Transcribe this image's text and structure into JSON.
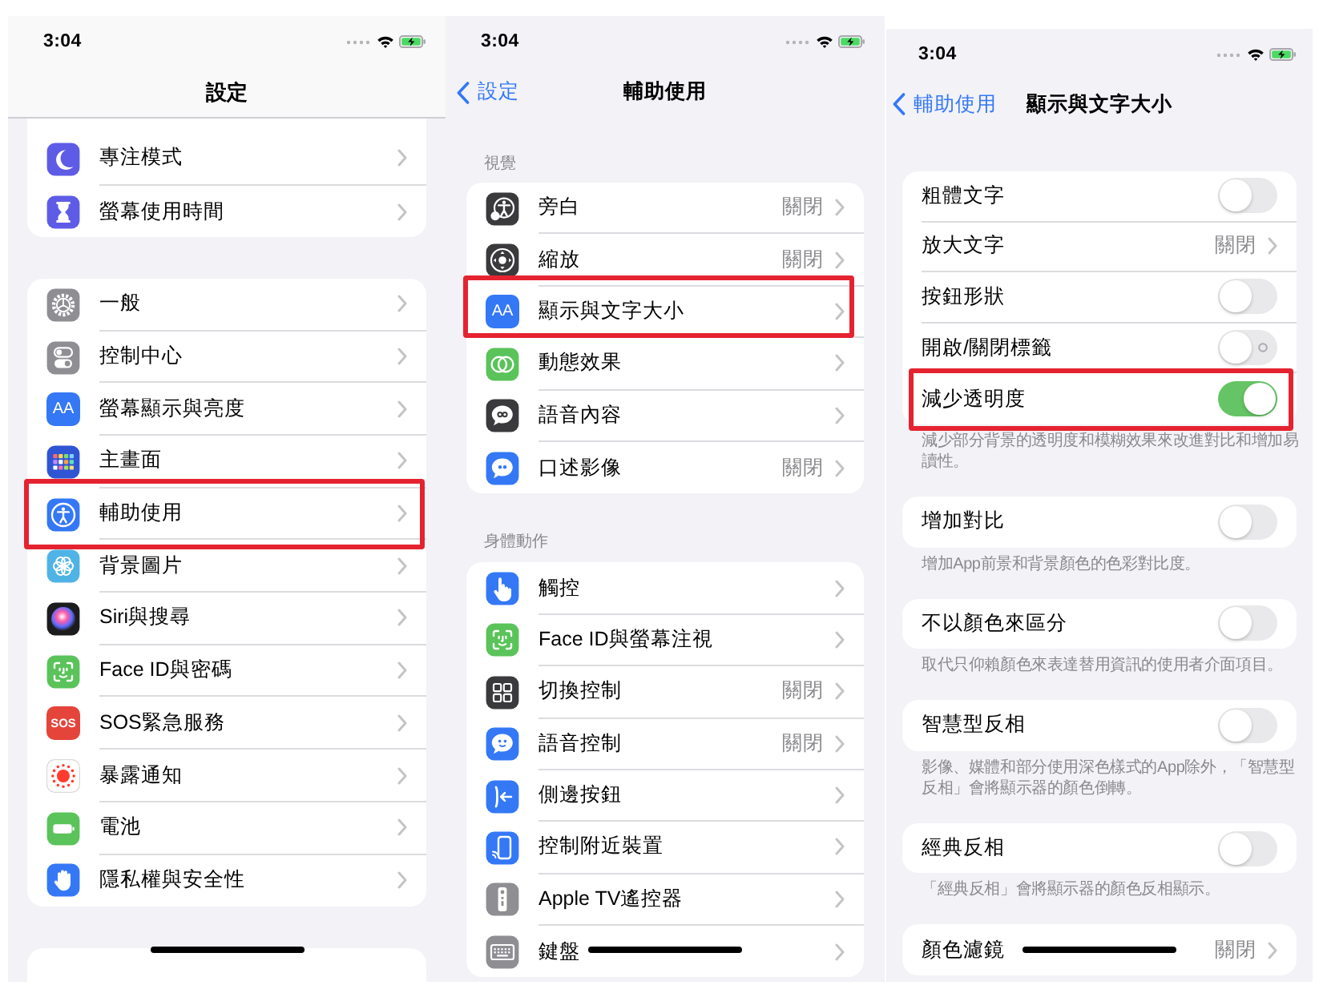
{
  "screens": [
    {
      "status_time": "3:04",
      "title": "設定",
      "groups": [
        {
          "items": [
            {
              "label": "專注模式",
              "highlighted": false
            },
            {
              "label": "螢幕使用時間",
              "highlighted": false
            }
          ]
        },
        {
          "items": [
            {
              "label": "一般",
              "highlighted": false
            },
            {
              "label": "控制中心",
              "highlighted": false
            },
            {
              "label": "螢幕顯示與亮度",
              "icon_text": "AA",
              "highlighted": false
            },
            {
              "label": "主畫面",
              "highlighted": false
            },
            {
              "label": "輔助使用",
              "highlighted": true
            },
            {
              "label": "背景圖片",
              "highlighted": false
            },
            {
              "label": "Siri與搜尋",
              "highlighted": false
            },
            {
              "label": "Face ID與密碼",
              "highlighted": false
            },
            {
              "label": "SOS緊急服務",
              "icon_text": "SOS",
              "highlighted": false
            },
            {
              "label": "暴露通知",
              "highlighted": false
            },
            {
              "label": "電池",
              "highlighted": false
            },
            {
              "label": "隱私權與安全性",
              "highlighted": false
            }
          ]
        }
      ]
    },
    {
      "status_time": "3:04",
      "back": "設定",
      "title": "輔助使用",
      "groups": [
        {
          "header": "視覺",
          "items": [
            {
              "label": "旁白",
              "value": "關閉",
              "highlighted": false
            },
            {
              "label": "縮放",
              "value": "關閉",
              "highlighted": false
            },
            {
              "label": "顯示與文字大小",
              "icon_text": "AA",
              "highlighted": true
            },
            {
              "label": "動態效果",
              "highlighted": false
            },
            {
              "label": "語音內容",
              "highlighted": false
            },
            {
              "label": "口述影像",
              "value": "關閉",
              "highlighted": false
            }
          ]
        },
        {
          "header": "身體動作",
          "items": [
            {
              "label": "觸控",
              "highlighted": false
            },
            {
              "label": "Face ID與螢幕注視",
              "highlighted": false
            },
            {
              "label": "切換控制",
              "value": "關閉",
              "highlighted": false
            },
            {
              "label": "語音控制",
              "value": "關閉",
              "highlighted": false
            },
            {
              "label": "側邊按鈕",
              "highlighted": false
            },
            {
              "label": "控制附近裝置",
              "highlighted": false
            },
            {
              "label": "Apple TV遙控器",
              "highlighted": false
            },
            {
              "label": "鍵盤",
              "highlighted": false
            }
          ]
        }
      ]
    },
    {
      "status_time": "3:04",
      "back": "輔助使用",
      "title": "顯示與文字大小",
      "groups": [
        {
          "items": [
            {
              "kind": "toggle",
              "label": "粗體文字",
              "on": false,
              "off_label": false,
              "highlighted": false
            },
            {
              "kind": "link",
              "label": "放大文字",
              "value": "關閉",
              "highlighted": false
            },
            {
              "kind": "toggle",
              "label": "按鈕形狀",
              "on": false,
              "off_label": false,
              "highlighted": false
            },
            {
              "kind": "toggle",
              "label": "開啟/關閉標籤",
              "on": false,
              "off_label": true,
              "highlighted": false
            },
            {
              "kind": "toggle",
              "label": "減少透明度",
              "on": true,
              "off_label": false,
              "highlighted": true
            }
          ],
          "footer": "減少部分背景的透明度和模糊效果來改進對比和增加易讀性。"
        },
        {
          "items": [
            {
              "kind": "toggle",
              "label": "增加對比",
              "on": false,
              "off_label": false,
              "highlighted": false
            }
          ],
          "footer": "增加App前景和背景顏色的色彩對比度。"
        },
        {
          "items": [
            {
              "kind": "toggle",
              "label": "不以顏色來區分",
              "on": false,
              "off_label": false,
              "highlighted": false
            }
          ],
          "footer": "取代只仰賴顏色來表達替用資訊的使用者介面項目。"
        },
        {
          "items": [
            {
              "kind": "toggle",
              "label": "智慧型反相",
              "on": false,
              "off_label": false,
              "highlighted": false
            }
          ],
          "footer": "影像、媒體和部分使用深色樣式的App除外，「智慧型反相」會將顯示器的顏色倒轉。"
        },
        {
          "items": [
            {
              "kind": "toggle",
              "label": "經典反相",
              "on": false,
              "off_label": false,
              "highlighted": false
            }
          ],
          "footer": "「經典反相」會將顯示器的顏色反相顯示。"
        },
        {
          "items": [
            {
              "kind": "link",
              "label": "顏色濾鏡",
              "value": "關閉",
              "highlighted": false
            }
          ]
        }
      ]
    }
  ]
}
